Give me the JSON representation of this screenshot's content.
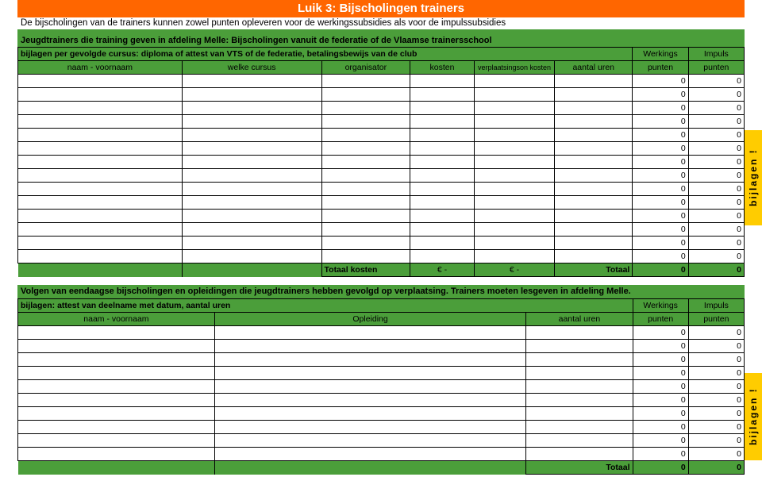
{
  "header": {
    "title": "Luik 3: Bijscholingen trainers",
    "subtitle": "De bijscholingen van de trainers kunnen zowel punten opleveren voor de werkingssubsidies als voor de impulssubsidies"
  },
  "section1": {
    "heading": "Jeugdtrainers die training geven in afdeling Melle: Bijscholingen vanuit de federatie of de Vlaamse trainersschool",
    "bijlagen": "bijlagen per gevolgde cursus: diploma of attest van VTS of de federatie, betalingsbewijs van de club",
    "werkings": "Werkings",
    "impuls": "Impuls",
    "cols": {
      "naam": "naam - voornaam",
      "cursus": "welke cursus",
      "organisator": "organisator",
      "kosten": "kosten",
      "verpl": "verplaatsingson kosten",
      "uren": "aantal uren",
      "punten": "punten",
      "punten2": "punten"
    },
    "rows": [
      {
        "p1": "0",
        "p2": "0"
      },
      {
        "p1": "0",
        "p2": "0"
      },
      {
        "p1": "0",
        "p2": "0"
      },
      {
        "p1": "0",
        "p2": "0"
      },
      {
        "p1": "0",
        "p2": "0"
      },
      {
        "p1": "0",
        "p2": "0"
      },
      {
        "p1": "0",
        "p2": "0"
      },
      {
        "p1": "0",
        "p2": "0"
      },
      {
        "p1": "0",
        "p2": "0"
      },
      {
        "p1": "0",
        "p2": "0"
      },
      {
        "p1": "0",
        "p2": "0"
      },
      {
        "p1": "0",
        "p2": "0"
      },
      {
        "p1": "0",
        "p2": "0"
      },
      {
        "p1": "0",
        "p2": "0"
      }
    ],
    "totaal": {
      "label": "Totaal kosten",
      "k1": "€          -",
      "k2": "€          -",
      "totlabel": "Totaal",
      "p1": "0",
      "p2": "0"
    },
    "sideLabel": "bijlagen !"
  },
  "section2": {
    "heading": "Volgen van eendaagse bijscholingen en opleidingen die jeugdtrainers hebben gevolgd op verplaatsing. Trainers moeten lesgeven in afdeling Melle.",
    "bijlagen": "bijlagen: attest van deelname met datum, aantal uren",
    "werkings": "Werkings",
    "impuls": "Impuls",
    "cols": {
      "naam": "naam - voornaam",
      "opleiding": "Opleiding",
      "uren": "aantal uren",
      "punten": "punten",
      "punten2": "punten"
    },
    "rows": [
      {
        "p1": "0",
        "p2": "0"
      },
      {
        "p1": "0",
        "p2": "0"
      },
      {
        "p1": "0",
        "p2": "0"
      },
      {
        "p1": "0",
        "p2": "0"
      },
      {
        "p1": "0",
        "p2": "0"
      },
      {
        "p1": "0",
        "p2": "0"
      },
      {
        "p1": "0",
        "p2": "0"
      },
      {
        "p1": "0",
        "p2": "0"
      },
      {
        "p1": "0",
        "p2": "0"
      },
      {
        "p1": "0",
        "p2": "0"
      }
    ],
    "totaal": {
      "label": "Totaal",
      "p1": "0",
      "p2": "0"
    },
    "sideLabel": "bijlagen !"
  }
}
